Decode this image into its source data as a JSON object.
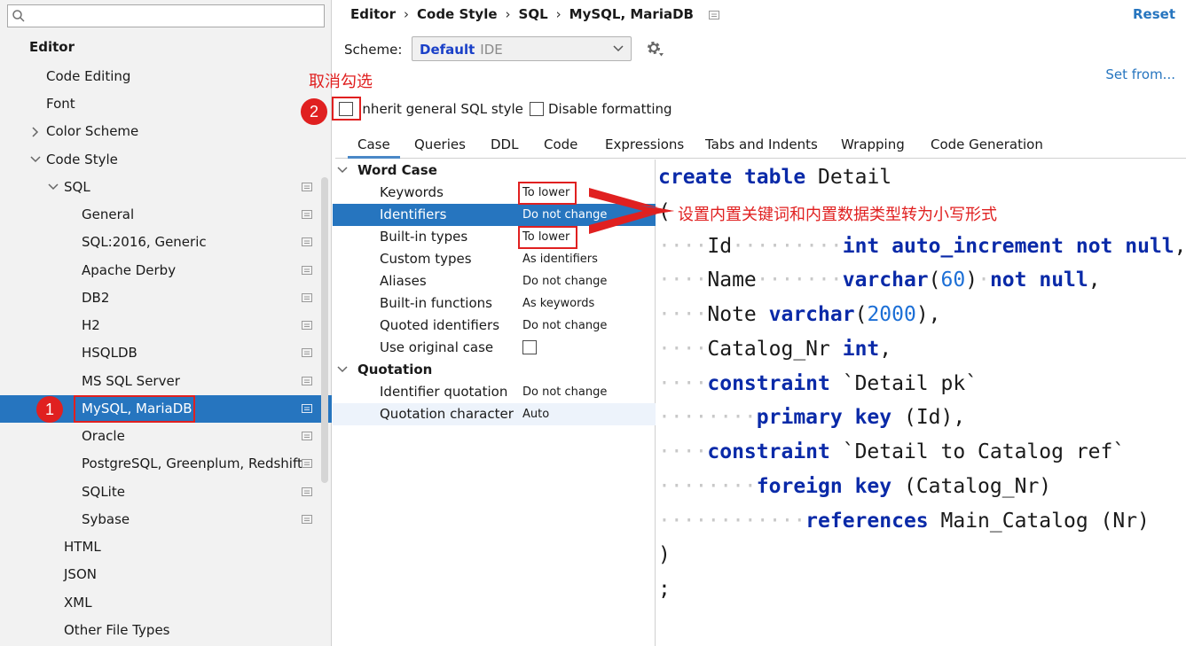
{
  "sidebar": {
    "search_placeholder": "",
    "items": [
      {
        "label": "Editor"
      },
      {
        "label": "Code Editing"
      },
      {
        "label": "Font"
      },
      {
        "label": "Color Scheme"
      },
      {
        "label": "Code Style"
      },
      {
        "label": "SQL"
      },
      {
        "label": "General"
      },
      {
        "label": "SQL:2016, Generic"
      },
      {
        "label": "Apache Derby"
      },
      {
        "label": "DB2"
      },
      {
        "label": "H2"
      },
      {
        "label": "HSQLDB"
      },
      {
        "label": "MS SQL Server"
      },
      {
        "label": "MySQL, MariaDB"
      },
      {
        "label": "Oracle"
      },
      {
        "label": "PostgreSQL, Greenplum, Redshift"
      },
      {
        "label": "SQLite"
      },
      {
        "label": "Sybase"
      },
      {
        "label": "HTML"
      },
      {
        "label": "JSON"
      },
      {
        "label": "XML"
      },
      {
        "label": "Other File Types"
      }
    ]
  },
  "header": {
    "breadcrumb": [
      "Editor",
      "Code Style",
      "SQL",
      "MySQL, MariaDB"
    ],
    "reset_label": "Reset",
    "scheme_label": "Scheme:",
    "scheme_value": "Default",
    "scheme_sub": "IDE",
    "set_from_label": "Set from..."
  },
  "options": {
    "inherit_label": "Inherit general SQL style",
    "disable_label": "Disable formatting"
  },
  "tabs": [
    "Case",
    "Queries",
    "DDL",
    "Code",
    "Expressions",
    "Tabs and Indents",
    "Wrapping",
    "Code Generation"
  ],
  "table": {
    "word_case_title": "Word Case",
    "quotation_title": "Quotation",
    "rows": [
      {
        "name": "Keywords",
        "value": "To lower"
      },
      {
        "name": "Identifiers",
        "value": "Do not change"
      },
      {
        "name": "Built-in types",
        "value": "To lower"
      },
      {
        "name": "Custom types",
        "value": "As identifiers"
      },
      {
        "name": "Aliases",
        "value": "Do not change"
      },
      {
        "name": "Built-in functions",
        "value": "As keywords"
      },
      {
        "name": "Quoted identifiers",
        "value": "Do not change"
      },
      {
        "name": "Use original case",
        "value": ""
      },
      {
        "name": "Identifier quotation",
        "value": "Do not change"
      },
      {
        "name": "Quotation character",
        "value": "Auto"
      }
    ]
  },
  "code": {
    "lines": [
      "create table Detail",
      "(",
      "Id int auto_increment not null,",
      "Name varchar(60) not null,",
      "Note varchar(2000),",
      "Catalog_Nr int,",
      "constraint `Detail pk`",
      "primary key (Id),",
      "constraint `Detail to Catalog ref`",
      "foreign key (Catalog_Nr)",
      "references Main_Catalog (Nr)",
      ")",
      ";"
    ]
  },
  "annotations": {
    "uncheck_text": "取消勾选",
    "convert_text": "设置内置关键词和内置数据类型转为小写形式",
    "marker_1": "1",
    "marker_2": "2"
  },
  "colors": {
    "selection": "#2675bf",
    "keyword": "#0a2aa8",
    "number": "#1c6fd6",
    "link": "#2675bf",
    "annotation": "#e02020"
  }
}
